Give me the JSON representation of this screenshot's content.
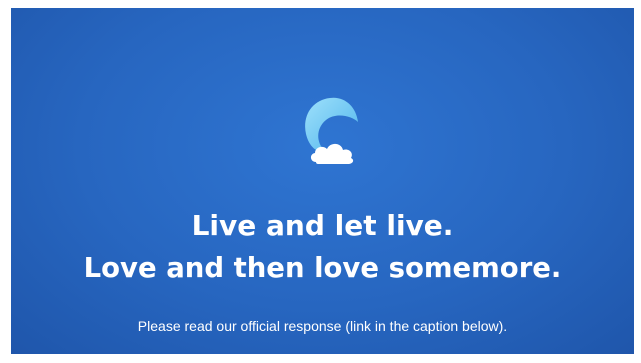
{
  "announcement": {
    "logo_icon": "wave-cloud-logo-icon",
    "line1": "Live and let live.",
    "line2": "Love and then love somemore.",
    "subtext": "Please read our official response (link in the caption below)."
  },
  "colors": {
    "background": "#2766c0",
    "logo_wave": "#7ccff2",
    "cloud": "#ffffff",
    "text": "#ffffff"
  }
}
